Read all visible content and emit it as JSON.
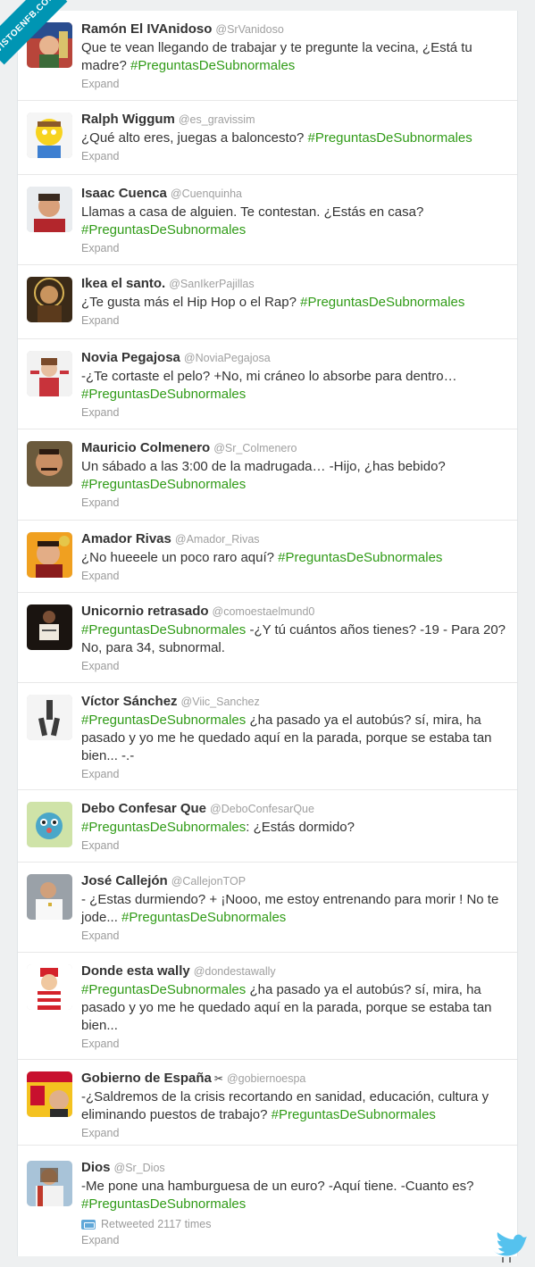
{
  "watermark": "VISTOENFB.COM",
  "tweets": [
    {
      "name": "Ramón El IVAnidoso",
      "handle": "@SrVanidoso",
      "text": "Que te vean llegando de trabajar y te pregunte la vecina, ¿Está tu madre? ",
      "hashtag": "#PreguntasDeSubnormales",
      "expand": "Expand"
    },
    {
      "name": "Ralph Wiggum",
      "handle": "@es_gravissim",
      "text": "¿Qué alto eres, juegas a baloncesto? ",
      "hashtag": "#PreguntasDeSubnormales",
      "expand": "Expand"
    },
    {
      "name": "Isaac Cuenca",
      "handle": "@Cuenquinha",
      "text": "Llamas a casa de alguien. Te contestan. ¿Estás en casa? ",
      "hashtag": "#PreguntasDeSubnormales",
      "expand": "Expand"
    },
    {
      "name": "Ikea el santo.",
      "handle": "@SanIkerPajillas",
      "text": "¿Te gusta más el Hip Hop o el Rap? ",
      "hashtag": "#PreguntasDeSubnormales",
      "expand": "Expand"
    },
    {
      "name": "Novia Pegajosa",
      "handle": "@NoviaPegajosa",
      "text": "-¿Te cortaste el pelo? +No, mi cráneo lo absorbe para dentro… ",
      "hashtag": "#PreguntasDeSubnormales",
      "expand": "Expand"
    },
    {
      "name": "Mauricio Colmenero",
      "handle": "@Sr_Colmenero",
      "text": "Un sábado a las 3:00 de la madrugada… -Hijo, ¿has bebido? ",
      "hashtag": "#PreguntasDeSubnormales",
      "expand": "Expand"
    },
    {
      "name": "Amador Rivas",
      "handle": "@Amador_Rivas",
      "text": "¿No hueeele un poco raro aquí? ",
      "hashtag": "#PreguntasDeSubnormales",
      "expand": "Expand"
    },
    {
      "name": "Unicornio retrasado",
      "handle": "@comoestaelmund0",
      "hashtag": "#PreguntasDeSubnormales",
      "text": " -¿Y tú cuántos años tienes? -19 - Para 20? No, para 34, subnormal.",
      "expand": "Expand"
    },
    {
      "name": "Víctor Sánchez",
      "handle": "@Viic_Sanchez",
      "hashtag": "#PreguntasDeSubnormales",
      "text": " ¿ha pasado ya el autobús? sí, mira, ha pasado y yo me he quedado aquí en la parada, porque se estaba tan bien... -.-",
      "expand": "Expand"
    },
    {
      "name": "Debo Confesar Que",
      "handle": "@DeboConfesarQue",
      "hashtag": "#PreguntasDeSubnormales",
      "text": ": ¿Estás dormido?",
      "expand": "Expand"
    },
    {
      "name": "José Callejón",
      "handle": "@CallejonTOP",
      "text": "- ¿Estas durmiendo? + ¡Nooo, me estoy entrenando para morir ! No te jode... ",
      "hashtag": "#PreguntasDeSubnormales",
      "expand": "Expand"
    },
    {
      "name": "Donde esta wally",
      "handle": "@dondestawally",
      "hashtag": "#PreguntasDeSubnormales",
      "text": " ¿ha pasado ya el autobús? sí, mira, ha pasado y yo me he quedado aquí en la parada, porque se estaba tan bien...",
      "expand": "Expand"
    },
    {
      "name": "Gobierno de España",
      "handle": "@gobiernoespa",
      "text": "-¿Saldremos de la crisis recortando en sanidad, educación, cultura y eliminando puestos de trabajo? ",
      "hashtag": "#PreguntasDeSubnormales",
      "expand": "Expand"
    },
    {
      "name": "Dios",
      "handle": "@Sr_Dios",
      "text": "-Me pone una hamburguesa de un euro? -Aquí tiene. -Cuanto es? ",
      "hashtag": "#PreguntasDeSubnormales",
      "retweeted": "Retweeted 2117 times",
      "expand": "Expand"
    }
  ]
}
